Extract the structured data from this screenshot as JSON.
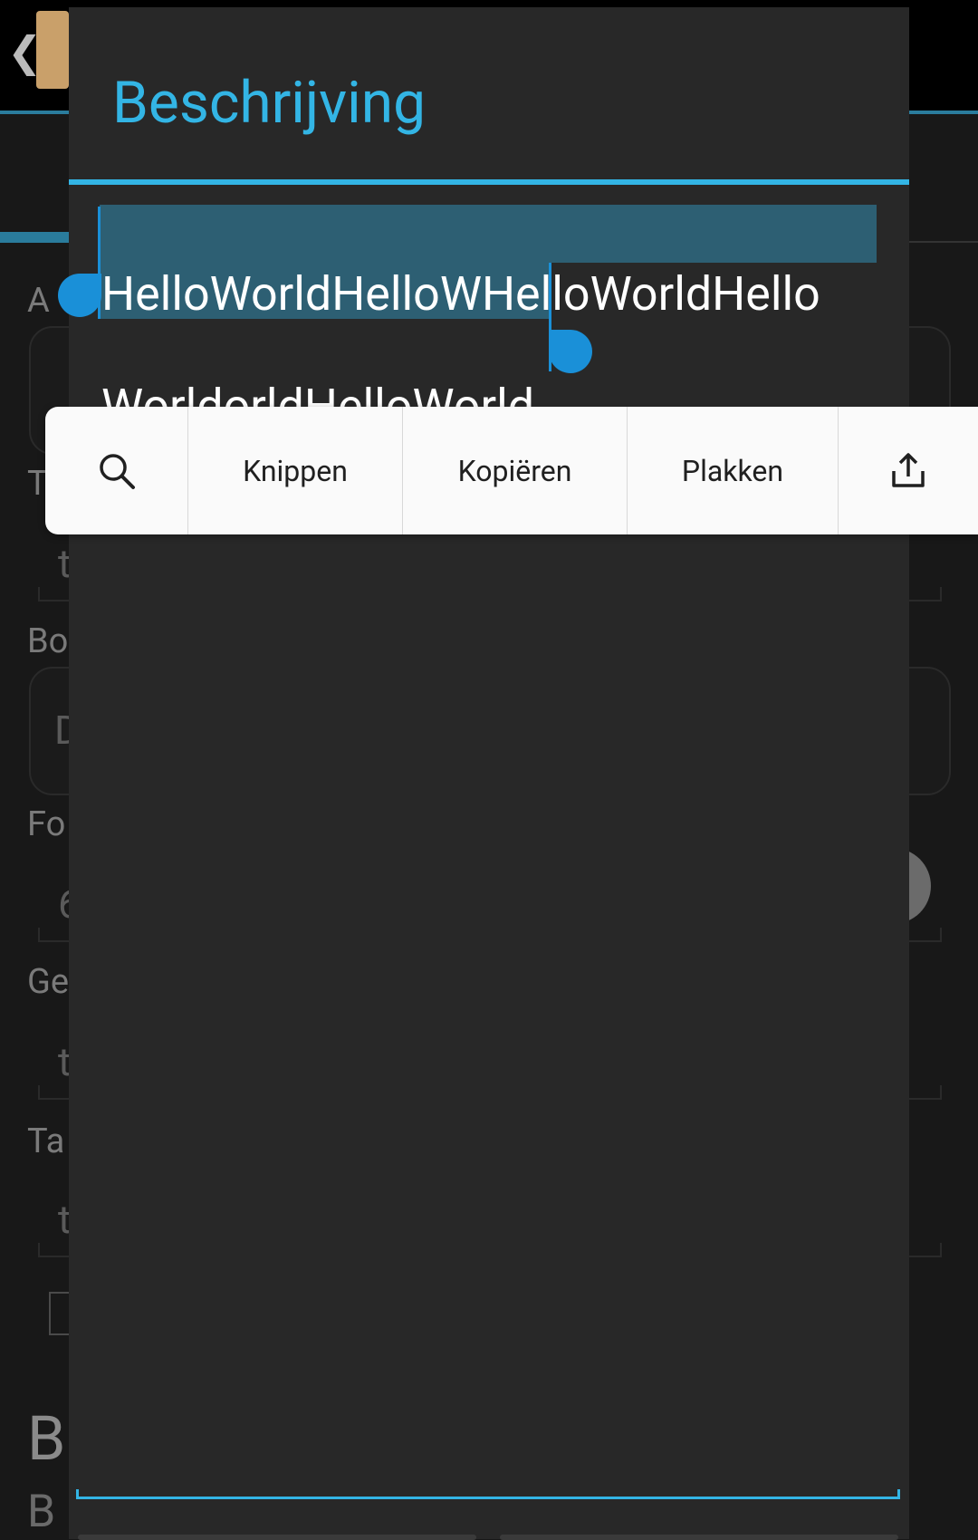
{
  "dialog": {
    "title": "Beschrijving",
    "text_line1": "HelloWorldHelloWHelloWorldHello",
    "text_line2": "WorldorldHelloWorld"
  },
  "toolbar": {
    "search_icon": "search-icon",
    "cut_label": "Knippen",
    "copy_label": "Kopiëren",
    "paste_label": "Plakken",
    "share_icon": "share-icon"
  },
  "colors": {
    "accent": "#33b5e5",
    "selection": "#2d5f73",
    "handle": "#1a90d8",
    "dialog_bg": "#282828"
  }
}
